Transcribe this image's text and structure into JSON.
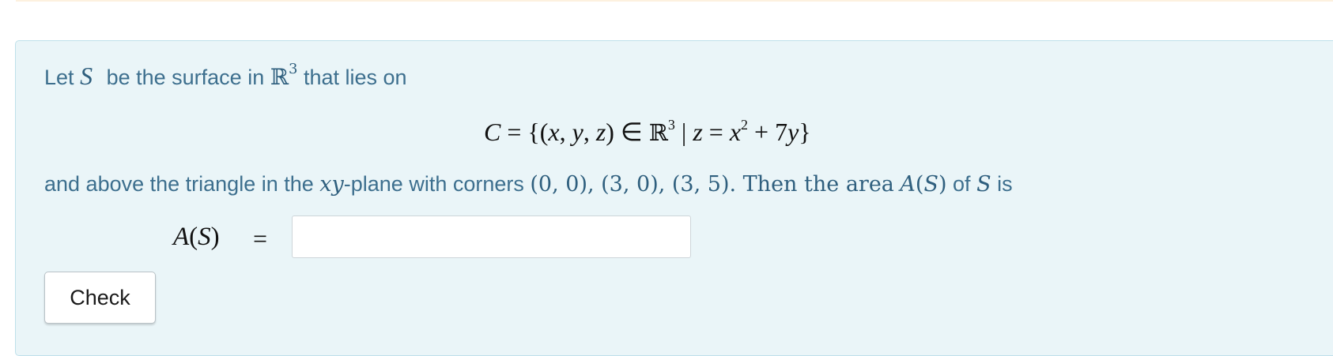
{
  "problem": {
    "intro_prefix": "Let",
    "intro_S": "S",
    "intro_middle": "be the surface in",
    "intro_R": "ℝ",
    "intro_R_exp": "3",
    "intro_suffix": "that lies on",
    "display_equation": {
      "lhs": "C",
      "eq1": " = {(",
      "x": "x",
      "comma1": ", ",
      "y": "y",
      "comma2": ", ",
      "z": "z",
      "close_tuple": ") ∈ ",
      "R": "ℝ",
      "R_exp": "3",
      "bar": " | ",
      "z2": "z",
      "eq2": " = ",
      "x2": "x",
      "x_exp": "2",
      "plus": " + 7",
      "y2": "y",
      "close_set": "}"
    },
    "line3_prefix": "and above the triangle in the",
    "xy": "xy",
    "line3_middle": "-plane with corners",
    "corners": "(0, 0), (3, 0), (3, 5)",
    "line3_after_corners": ". Then the area",
    "area_A": "A",
    "area_S": "S",
    "line3_of": "of",
    "line3_S": "S",
    "line3_is": "is"
  },
  "answer": {
    "label_A": "A",
    "label_S": "S",
    "equals": "=",
    "input_value": "",
    "input_placeholder": ""
  },
  "actions": {
    "check_label": "Check"
  },
  "colors": {
    "panel_background": "#eaf5f8",
    "panel_border": "#bfe0ea",
    "text": "#3d6f8e",
    "top_strip": "#fdf1df"
  }
}
